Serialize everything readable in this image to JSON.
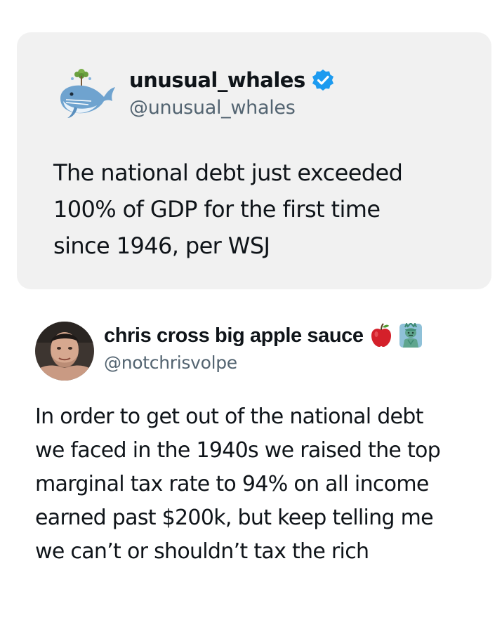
{
  "quoted_tweet": {
    "author_name": "unusual_whales",
    "author_handle": "@unusual_whales",
    "verified_icon": "verified-badge-icon",
    "avatar_icon": "whale-logo-icon",
    "text_lines": [
      "The national debt just exceeded",
      "100% of GDP for the first time",
      "since 1946, per WSJ"
    ]
  },
  "reply_tweet": {
    "author_name": "chris cross big apple sauce",
    "author_handle": "@notchrisvolpe",
    "name_emojis": [
      "apple-icon",
      "statue-of-liberty-icon"
    ],
    "text_lines": [
      "In order to get out of the national debt",
      "we faced in the 1940s we raised the top",
      "marginal tax rate to 94% on all income",
      "earned past $200k, but keep telling me",
      "we can’t or shouldn’t tax the rich"
    ]
  },
  "colors": {
    "card_background": "#f1f1f1",
    "handle_gray": "#536471",
    "verified_blue": "#1d9bf0",
    "whale_blue": "#6fa3cf",
    "apple_red": "#d4202a",
    "liberty_green": "#5fa58e"
  }
}
